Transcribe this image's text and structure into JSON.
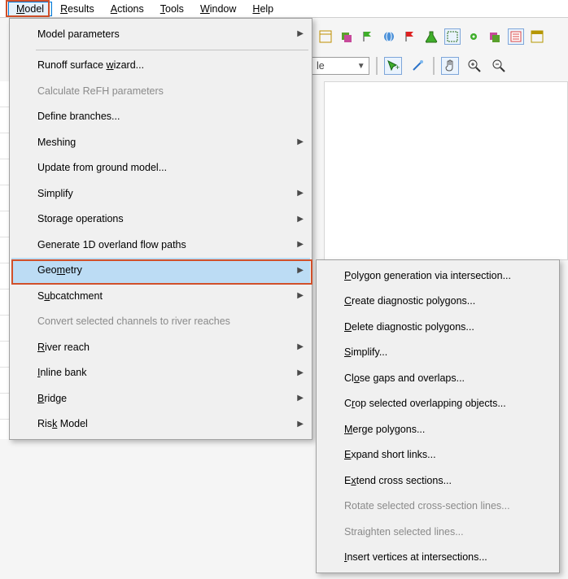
{
  "menubar": {
    "items": [
      {
        "label": "Model",
        "underline": "M",
        "rest": "odel"
      },
      {
        "label": "Results",
        "underline": "R",
        "rest": "esults"
      },
      {
        "label": "Actions",
        "underline": "A",
        "rest": "ctions"
      },
      {
        "label": "Tools",
        "underline": "T",
        "rest": "ools"
      },
      {
        "label": "Window",
        "underline": "W",
        "rest": "indow"
      },
      {
        "label": "Help",
        "underline": "H",
        "rest": "elp"
      }
    ],
    "selected_index": 0
  },
  "toolbarRow1": {
    "icons": [
      "panel-icon",
      "layers-icon",
      "flag-green-icon",
      "world-icon",
      "flag-red-icon",
      "flask-icon",
      "select-box-icon",
      "gear-icon",
      "layers2-icon",
      "list-icon",
      "panel2-icon"
    ]
  },
  "toolbarRow2": {
    "combo_value": "le",
    "icons": [
      "cursor-plus-icon",
      "wand-icon",
      "hand-icon",
      "zoom-in-icon",
      "zoom-out-icon"
    ]
  },
  "modelMenu": {
    "items": [
      {
        "text": "Model parameters",
        "submenu": true
      },
      {
        "sep": true
      },
      {
        "text": "Runoff surface wizard...",
        "underline_pre": "Runoff surface ",
        "underline_ch": "w",
        "underline_post": "izard..."
      },
      {
        "text": "Calculate ReFH parameters",
        "disabled": true
      },
      {
        "text": "Define branches..."
      },
      {
        "text": "Meshing",
        "submenu": true
      },
      {
        "text": "Update from ground model..."
      },
      {
        "text": "Simplify",
        "submenu": true
      },
      {
        "text": "Storage operations",
        "submenu": true
      },
      {
        "text": "Generate 1D overland flow paths",
        "submenu": true
      },
      {
        "text": "Geometry",
        "underline_pre": "Geo",
        "underline_ch": "m",
        "underline_post": "etry",
        "submenu": true,
        "highlight": true
      },
      {
        "text": "Subcatchment",
        "underline_pre": "S",
        "underline_ch": "u",
        "underline_post": "bcatchment",
        "submenu": true
      },
      {
        "text": "Convert selected channels to river reaches",
        "disabled": true
      },
      {
        "text": "River reach",
        "underline_pre": "",
        "underline_ch": "R",
        "underline_post": "iver reach",
        "submenu": true
      },
      {
        "text": "Inline bank",
        "underline_pre": "",
        "underline_ch": "I",
        "underline_post": "nline bank",
        "submenu": true
      },
      {
        "text": "Bridge",
        "underline_pre": "",
        "underline_ch": "B",
        "underline_post": "ridge",
        "submenu": true
      },
      {
        "text": "Risk Model",
        "underline_pre": "Ris",
        "underline_ch": "k",
        "underline_post": " Model",
        "submenu": true
      }
    ]
  },
  "geometryMenu": {
    "items": [
      {
        "text": "Polygon generation via intersection...",
        "underline_pre": "",
        "underline_ch": "P",
        "underline_post": "olygon generation via intersection..."
      },
      {
        "text": "Create diagnostic polygons...",
        "underline_pre": "",
        "underline_ch": "C",
        "underline_post": "reate diagnostic polygons..."
      },
      {
        "text": "Delete diagnostic polygons...",
        "underline_pre": "",
        "underline_ch": "D",
        "underline_post": "elete diagnostic polygons..."
      },
      {
        "text": "Simplify...",
        "underline_pre": "",
        "underline_ch": "S",
        "underline_post": "implify..."
      },
      {
        "text": "Close gaps and overlaps...",
        "underline_pre": "Cl",
        "underline_ch": "o",
        "underline_post": "se gaps and overlaps..."
      },
      {
        "text": "Crop selected overlapping objects...",
        "underline_pre": "C",
        "underline_ch": "r",
        "underline_post": "op selected overlapping objects..."
      },
      {
        "text": "Merge polygons...",
        "underline_pre": "",
        "underline_ch": "M",
        "underline_post": "erge polygons..."
      },
      {
        "text": "Expand short links...",
        "underline_pre": "",
        "underline_ch": "E",
        "underline_post": "xpand short links..."
      },
      {
        "text": "Extend cross sections...",
        "underline_pre": "E",
        "underline_ch": "x",
        "underline_post": "tend cross sections..."
      },
      {
        "text": "Rotate selected cross-section lines...",
        "disabled": true
      },
      {
        "text": "Straighten selected lines...",
        "disabled": true
      },
      {
        "text": "Insert vertices at intersections...",
        "underline_pre": "",
        "underline_ch": "I",
        "underline_post": "nsert vertices at intersections..."
      }
    ]
  }
}
